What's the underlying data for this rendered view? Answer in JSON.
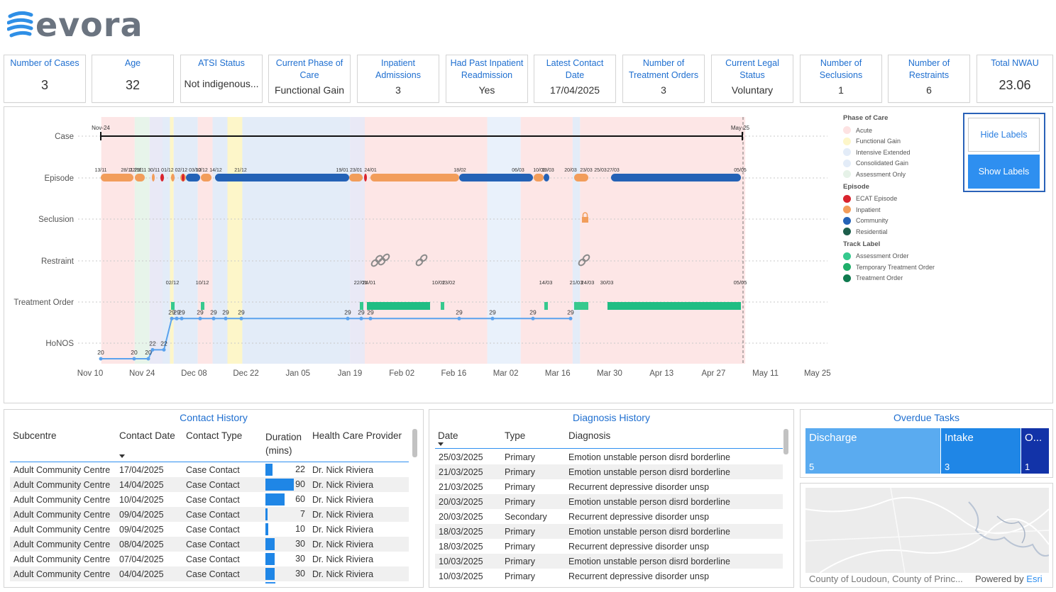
{
  "brand": {
    "name": "evora"
  },
  "kpis": [
    {
      "title": "Number of Cases",
      "value": "3"
    },
    {
      "title": "Age",
      "value": "32"
    },
    {
      "title": "ATSI Status",
      "value": "Not indigenous..."
    },
    {
      "title": "Current Phase of Care",
      "value": "Functional Gain"
    },
    {
      "title": "Inpatient Admissions",
      "value": "3"
    },
    {
      "title": "Had Past Inpatient Readmission",
      "value": "Yes"
    },
    {
      "title": "Latest Contact Date",
      "value": "17/04/2025"
    },
    {
      "title": "Number of Treatment Orders",
      "value": "3"
    },
    {
      "title": "Current Legal Status",
      "value": "Voluntary"
    },
    {
      "title": "Number of Seclusions",
      "value": "1"
    },
    {
      "title": "Number of Restraints",
      "value": "6"
    },
    {
      "title": "Total NWAU",
      "value": "23.06"
    }
  ],
  "timeline": {
    "rows": [
      "Case",
      "Episode",
      "Seclusion",
      "Restraint",
      "Treatment Order",
      "HoNOS"
    ],
    "x_ticks": [
      "Nov 10",
      "Nov 24",
      "Dec 08",
      "Dec 22",
      "Jan 05",
      "Jan 19",
      "Feb 02",
      "Feb 16",
      "Mar 02",
      "Mar 16",
      "Mar 30",
      "Apr 13",
      "Apr 27",
      "May 11",
      "May 25"
    ],
    "case_labels": {
      "start": "Nov-24",
      "end": "May 25"
    },
    "episode_labels": [
      "13/11",
      "22/11",
      "28/11 29/11 30/11 01/12 02/12 03/12",
      "10/12",
      "14/12",
      "21/12",
      "19/01 23/01",
      "24/01",
      "18/02",
      "06/03",
      "10/03",
      "13/03",
      "20/03",
      "23/03",
      "25/03",
      "27/03",
      "31/03",
      "05/05"
    ],
    "order_labels": [
      "02/12",
      "10/12",
      "22/01",
      "24/01",
      "10/02",
      "13/02",
      "14/03",
      "21/03",
      "24/03",
      "30/03",
      "05/05"
    ],
    "honos_values": [
      20,
      20,
      20,
      22,
      22,
      29,
      29,
      29,
      29,
      29,
      29,
      29,
      29,
      29,
      29,
      29,
      29,
      29,
      29
    ]
  },
  "legend": {
    "phase_title": "Phase of Care",
    "phase_items": [
      {
        "label": "Acute",
        "color": "#fde2e2"
      },
      {
        "label": "Functional Gain",
        "color": "#fdf6c9"
      },
      {
        "label": "Intensive Extended",
        "color": "#e3ecf8"
      },
      {
        "label": "Consolidated Gain",
        "color": "#e3ecf8"
      },
      {
        "label": "Assessment Only",
        "color": "#e6f2e8"
      }
    ],
    "episode_title": "Episode",
    "episode_items": [
      {
        "label": "ECAT Episode",
        "color": "#d9242e"
      },
      {
        "label": "Inpatient",
        "color": "#f29d5b"
      },
      {
        "label": "Community",
        "color": "#2462b6"
      },
      {
        "label": "Residential",
        "color": "#1d5e4b"
      }
    ],
    "track_title": "Track Label",
    "track_items": [
      {
        "label": "Assessment Order",
        "color": "#36c98e"
      },
      {
        "label": "Temporary Treatment Order",
        "color": "#1fae6a"
      },
      {
        "label": "Treatment Order",
        "color": "#0f7a4f"
      }
    ]
  },
  "buttons": {
    "hide": "Hide Labels",
    "show": "Show Labels"
  },
  "contact_history": {
    "title": "Contact History",
    "headers": [
      "Subcentre",
      "Contact Date",
      "Contact Type",
      "Duration (mins)",
      "Health Care Provider"
    ],
    "rows": [
      {
        "subcentre": "Adult Community Centre",
        "date": "17/04/2025",
        "type": "Case Contact",
        "duration": 22,
        "provider": "Dr. Nick Riviera"
      },
      {
        "subcentre": "Adult Community Centre",
        "date": "14/04/2025",
        "type": "Case Contact",
        "duration": 90,
        "provider": "Dr. Nick Riviera"
      },
      {
        "subcentre": "Adult Community Centre",
        "date": "10/04/2025",
        "type": "Case Contact",
        "duration": 60,
        "provider": "Dr. Nick Riviera"
      },
      {
        "subcentre": "Adult Community Centre",
        "date": "09/04/2025",
        "type": "Case Contact",
        "duration": 7,
        "provider": "Dr. Nick Riviera"
      },
      {
        "subcentre": "Adult Community Centre",
        "date": "09/04/2025",
        "type": "Case Contact",
        "duration": 10,
        "provider": "Dr. Nick Riviera"
      },
      {
        "subcentre": "Adult Community Centre",
        "date": "08/04/2025",
        "type": "Case Contact",
        "duration": 30,
        "provider": "Dr. Nick Riviera"
      },
      {
        "subcentre": "Adult Community Centre",
        "date": "07/04/2025",
        "type": "Case Contact",
        "duration": 30,
        "provider": "Dr. Nick Riviera"
      },
      {
        "subcentre": "Adult Community Centre",
        "date": "04/04/2025",
        "type": "Case Contact",
        "duration": 30,
        "provider": "Dr. Nick Riviera"
      }
    ]
  },
  "diagnosis_history": {
    "title": "Diagnosis History",
    "headers": [
      "Date",
      "Type",
      "Diagnosis"
    ],
    "rows": [
      {
        "date": "25/03/2025",
        "type": "Primary",
        "diagnosis": "Emotion unstable person disrd borderline"
      },
      {
        "date": "21/03/2025",
        "type": "Primary",
        "diagnosis": "Emotion unstable person disrd borderline"
      },
      {
        "date": "21/03/2025",
        "type": "Primary",
        "diagnosis": "Recurrent depressive disorder unsp"
      },
      {
        "date": "20/03/2025",
        "type": "Primary",
        "diagnosis": "Emotion unstable person disrd borderline"
      },
      {
        "date": "20/03/2025",
        "type": "Secondary",
        "diagnosis": "Recurrent depressive disorder unsp"
      },
      {
        "date": "18/03/2025",
        "type": "Primary",
        "diagnosis": "Emotion unstable person disrd borderline"
      },
      {
        "date": "18/03/2025",
        "type": "Primary",
        "diagnosis": "Recurrent depressive disorder unsp"
      },
      {
        "date": "10/03/2025",
        "type": "Primary",
        "diagnosis": "Emotion unstable person disrd borderline"
      },
      {
        "date": "10/03/2025",
        "type": "Primary",
        "diagnosis": "Recurrent depressive disorder unsp"
      }
    ]
  },
  "overdue_tasks": {
    "title": "Overdue Tasks",
    "items": [
      {
        "label": "Discharge",
        "count": "5",
        "color": "#5aabf0"
      },
      {
        "label": "Intake",
        "count": "3",
        "color": "#1f86e6"
      },
      {
        "label": "O...",
        "count": "1",
        "color": "#1233a8"
      }
    ]
  },
  "map": {
    "attribution": "County of Loudoun, County of Princ...",
    "powered": "Powered by",
    "esri": "Esri"
  }
}
